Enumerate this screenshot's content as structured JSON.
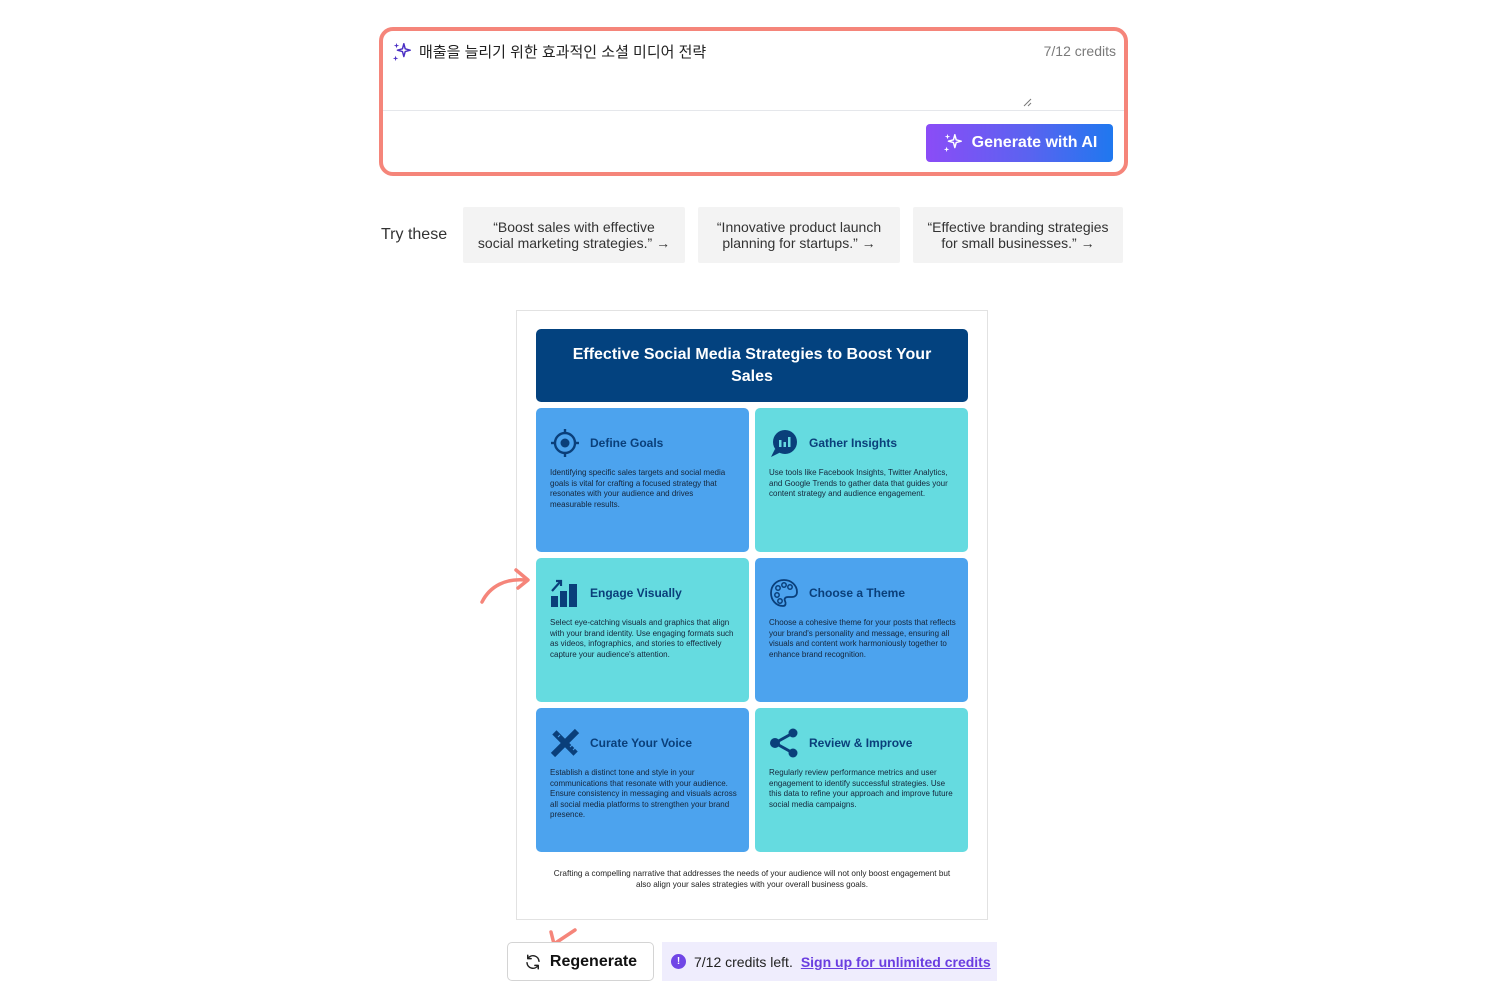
{
  "prompt": {
    "text": "매출을 늘리기 위한 효과적인 소셜 미디어 전략",
    "credits": "7/12 credits",
    "generate_label": "Generate with AI",
    "border_color": "#f5857a"
  },
  "suggestions": {
    "label": "Try these",
    "items": [
      {
        "line1": "“Boost sales with effective",
        "line2": "social marketing strategies.” →"
      },
      {
        "line1": "“Innovative product launch",
        "line2": "planning for startups.” →"
      },
      {
        "line1": "“Effective branding strategies",
        "line2": "for small businesses.” →"
      }
    ]
  },
  "infographic": {
    "title": "Effective Social Media Strategies to Boost Your Sales",
    "cards": [
      {
        "icon": "target-icon",
        "title": "Define Goals",
        "body": "Identifying specific sales targets and social media goals is vital for crafting a focused strategy that resonates with your audience and drives measurable results.",
        "color": "#4ca3ee"
      },
      {
        "icon": "chat-chart-icon",
        "title": "Gather Insights",
        "body": "Use tools like Facebook Insights, Twitter Analytics, and Google Trends to gather data that guides your content strategy and audience engagement.",
        "color": "#65dbe0"
      },
      {
        "icon": "growth-chart-icon",
        "title": "Engage Visually",
        "body": "Select eye-catching visuals and graphics that align with your brand identity. Use engaging formats such as videos, infographics, and stories to effectively capture your audience's attention.",
        "color": "#65dbe0"
      },
      {
        "icon": "palette-icon",
        "title": "Choose a Theme",
        "body": "Choose a cohesive theme for your posts that reflects your brand's personality and message, ensuring all visuals and content work harmoniously together to enhance brand recognition.",
        "color": "#4ca3ee"
      },
      {
        "icon": "pencil-ruler-icon",
        "title": "Curate Your Voice",
        "body": "Establish a distinct tone and style in your communications that resonate with your audience. Ensure consistency in messaging and visuals across all social media platforms to strengthen your brand presence.",
        "color": "#4ca3ee"
      },
      {
        "icon": "share-icon",
        "title": "Review & Improve",
        "body": "Regularly review performance metrics and user engagement to identify successful strategies. Use this data to refine your approach and improve future social media campaigns.",
        "color": "#65dbe0"
      }
    ],
    "footer": "Crafting a compelling narrative that addresses the needs of your audience will not only boost engagement but also align your sales strategies with your overall business goals."
  },
  "bottom": {
    "regenerate_label": "Regenerate",
    "credits_text": "7/12 credits left.",
    "signup_label": "Sign up for unlimited credits",
    "info_glyph": "!"
  }
}
